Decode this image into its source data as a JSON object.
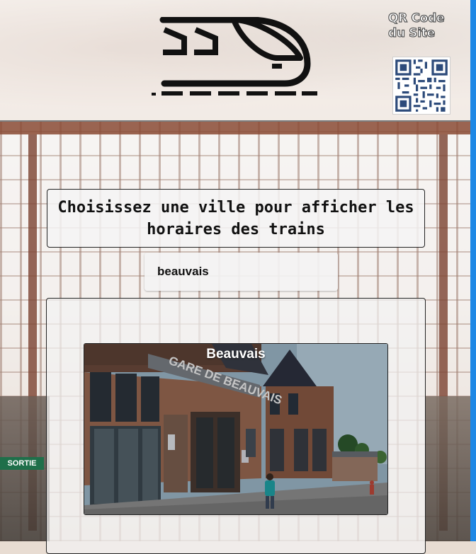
{
  "header": {
    "logo_icon": "train-icon",
    "qr": {
      "title_line1": "QR Code",
      "title_line2": "du Site",
      "icon": "qr-code-icon"
    }
  },
  "main": {
    "title": "Choisissez une ville pour afficher les horaires des trains",
    "city_select": {
      "value": "beauvais"
    },
    "station_card": {
      "name": "Beauvais",
      "building_sign": "GARE DE BEAUVAIS"
    }
  },
  "background": {
    "sign_sortie": "SORTIE"
  },
  "colors": {
    "accent_bar": "#1e88e5"
  }
}
